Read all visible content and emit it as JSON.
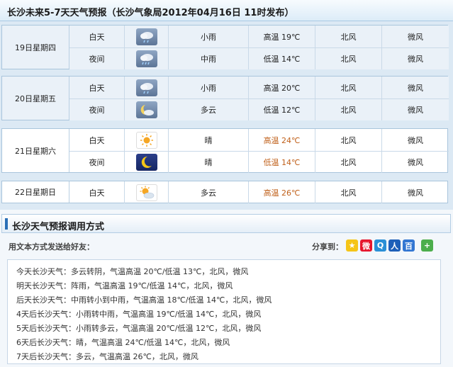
{
  "header": {
    "title": "长沙未来5-7天天气预报（长沙气象局2012年04月16日 11时发布）"
  },
  "days": [
    {
      "date": "19日星期四",
      "rows": [
        {
          "period": "白天",
          "icon": "light-rain-icon",
          "weather": "小雨",
          "temp": "高温 19℃",
          "wind_dir": "北风",
          "wind_force": "微风"
        },
        {
          "period": "夜间",
          "icon": "moderate-rain-icon",
          "weather": "中雨",
          "temp": "低温 14℃",
          "wind_dir": "北风",
          "wind_force": "微风"
        }
      ]
    },
    {
      "date": "20日星期五",
      "rows": [
        {
          "period": "白天",
          "icon": "light-rain-icon",
          "weather": "小雨",
          "temp": "高温 20℃",
          "wind_dir": "北风",
          "wind_force": "微风"
        },
        {
          "period": "夜间",
          "icon": "cloudy-night-icon",
          "weather": "多云",
          "temp": "低温 12℃",
          "wind_dir": "北风",
          "wind_force": "微风"
        }
      ]
    },
    {
      "date": "21日星期六",
      "rows": [
        {
          "period": "白天",
          "icon": "sunny-icon",
          "weather": "晴",
          "temp": "高温 24℃",
          "wind_dir": "北风",
          "wind_force": "微风"
        },
        {
          "period": "夜间",
          "icon": "clear-night-icon",
          "weather": "晴",
          "temp": "低温 14℃",
          "wind_dir": "北风",
          "wind_force": "微风"
        }
      ]
    },
    {
      "date": "22日星期日",
      "rows": [
        {
          "period": "白天",
          "icon": "partly-cloudy-icon",
          "weather": "多云",
          "temp": "高温 26℃",
          "wind_dir": "北风",
          "wind_force": "微风"
        }
      ]
    }
  ],
  "share": {
    "title": "长沙天气预报调用方式",
    "send_label": "用文本方式发送给好友：",
    "share_to": "分享到：",
    "icons": [
      "qzone-icon",
      "weibo-icon",
      "tencent-weibo-icon",
      "renren-icon",
      "baidu-icon",
      "more-share-icon"
    ],
    "lines": [
      "今天长沙天气：多云转阴，气温高温 20℃/低温 13℃，北风，微风",
      "明天长沙天气：阵雨，气温高温 19℃/低温 14℃，北风，微风",
      "后天长沙天气：中雨转小到中雨，气温高温 18℃/低温 14℃，北风，微风",
      "4天后长沙天气：小雨转中雨，气温高温 19℃/低温 14℃，北风，微风",
      "5天后长沙天气：小雨转多云，气温高温 20℃/低温 12℃，北风，微风",
      "6天后长沙天气：晴，气温高温 24℃/低温 14℃，北风，微风",
      "7天后长沙天气：多云，气温高温 26℃，北风，微风"
    ]
  },
  "colors": {
    "accent": "#2b6fb6",
    "hot_temp": "#c0601a",
    "table_bg": "#dce9f4"
  }
}
